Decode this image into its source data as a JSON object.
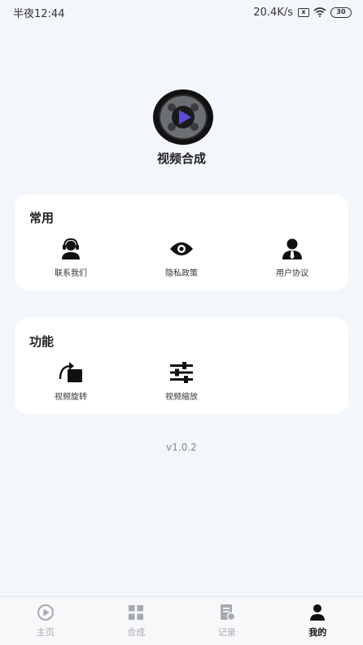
{
  "status_bar": {
    "time": "半夜12:44",
    "network_speed": "20.4K/s",
    "sim_icon": "x",
    "battery_level": "30"
  },
  "app": {
    "title": "视频合成",
    "version": "v1.0.2"
  },
  "common": {
    "title": "常用",
    "items": [
      {
        "label": "联系我们",
        "icon": "headset-person-icon"
      },
      {
        "label": "隐私政策",
        "icon": "eye-icon"
      },
      {
        "label": "用户协议",
        "icon": "user-tie-icon"
      }
    ]
  },
  "functions": {
    "title": "功能",
    "items": [
      {
        "label": "视频旋转",
        "icon": "rotate-icon"
      },
      {
        "label": "视频缩放",
        "icon": "sliders-icon"
      }
    ]
  },
  "tabbar": {
    "tabs": [
      {
        "label": "主页",
        "icon": "play-circle-icon",
        "active": false
      },
      {
        "label": "合成",
        "icon": "grid-icon",
        "active": false
      },
      {
        "label": "记录",
        "icon": "document-icon",
        "active": false
      },
      {
        "label": "我的",
        "icon": "person-icon",
        "active": true
      }
    ]
  },
  "colors": {
    "background": "#f3f6fb",
    "card": "#ffffff",
    "active_tab": "#111111",
    "inactive_tab": "#a6a9ae"
  }
}
